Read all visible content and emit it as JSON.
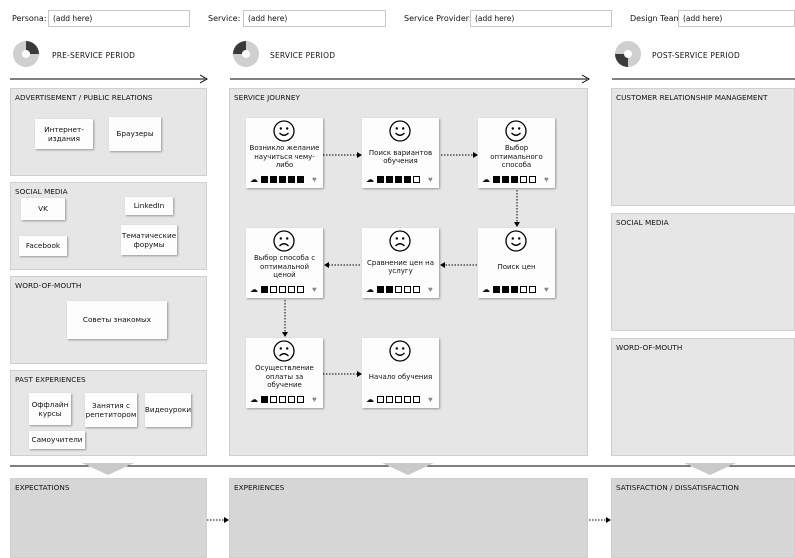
{
  "header": {
    "persona_label": "Persona:",
    "persona_value": "(add here)",
    "service_label": "Service:",
    "service_value": "(add here)",
    "provider_label": "Service Provider:",
    "provider_value": "(add here)",
    "team_label": "Design Team:",
    "team_value": "(add here)"
  },
  "periods": {
    "pre": "PRE-SERVICE PERIOD",
    "service": "SERVICE PERIOD",
    "post": "POST-SERVICE PERIOD"
  },
  "pre_service": {
    "advertisement": {
      "title": "ADVERTISEMENT / PUBLIC RELATIONS",
      "notes": [
        "Интернет-издания",
        "Браузеры"
      ]
    },
    "social_media": {
      "title": "SOCIAL MEDIA",
      "notes": [
        "VK",
        "LinkedIn",
        "Facebook",
        "Тематические форумы"
      ]
    },
    "word_of_mouth": {
      "title": "WORD-OF-MOUTH",
      "notes": [
        "Советы знакомых"
      ]
    },
    "past_experiences": {
      "title": "PAST EXPERIENCES",
      "notes": [
        "Оффлайн курсы",
        "Занятия с репетитором",
        "Видеоуроки",
        "Самоучители"
      ]
    }
  },
  "service_journey": {
    "title": "SERVICE JOURNEY",
    "steps": [
      {
        "text": "Возникло желание научиться чему-либо",
        "mood": "happy",
        "rating": 5
      },
      {
        "text": "Поиск вариантов обучения",
        "mood": "happy",
        "rating": 4
      },
      {
        "text": "Выбор оптимального способа",
        "mood": "happy",
        "rating": 3
      },
      {
        "text": "Поиск цен",
        "mood": "happy",
        "rating": 3
      },
      {
        "text": "Сравнение цен на услугу",
        "mood": "sad",
        "rating": 2
      },
      {
        "text": "Выбор способа с оптимальной ценой",
        "mood": "sad",
        "rating": 1
      },
      {
        "text": "Осуществление оплаты за обучение",
        "mood": "sad",
        "rating": 1
      },
      {
        "text": "Начало обучения",
        "mood": "happy",
        "rating": 0
      }
    ]
  },
  "post_service": {
    "crm": "CUSTOMER RELATIONSHIP MANAGEMENT",
    "social_media": "SOCIAL MEDIA",
    "word_of_mouth": "WORD-OF-MOUTH"
  },
  "bottom": {
    "expectations": "EXPECTATIONS",
    "experiences": "EXPERIENCES",
    "satisfaction": "SATISFACTION / DISSATISFACTION"
  },
  "colors": {
    "panel": "#e6e6e6",
    "border": "#cfcfcf",
    "bottom_panel": "#d6d6d6",
    "triangle": "#c9c9c9"
  }
}
